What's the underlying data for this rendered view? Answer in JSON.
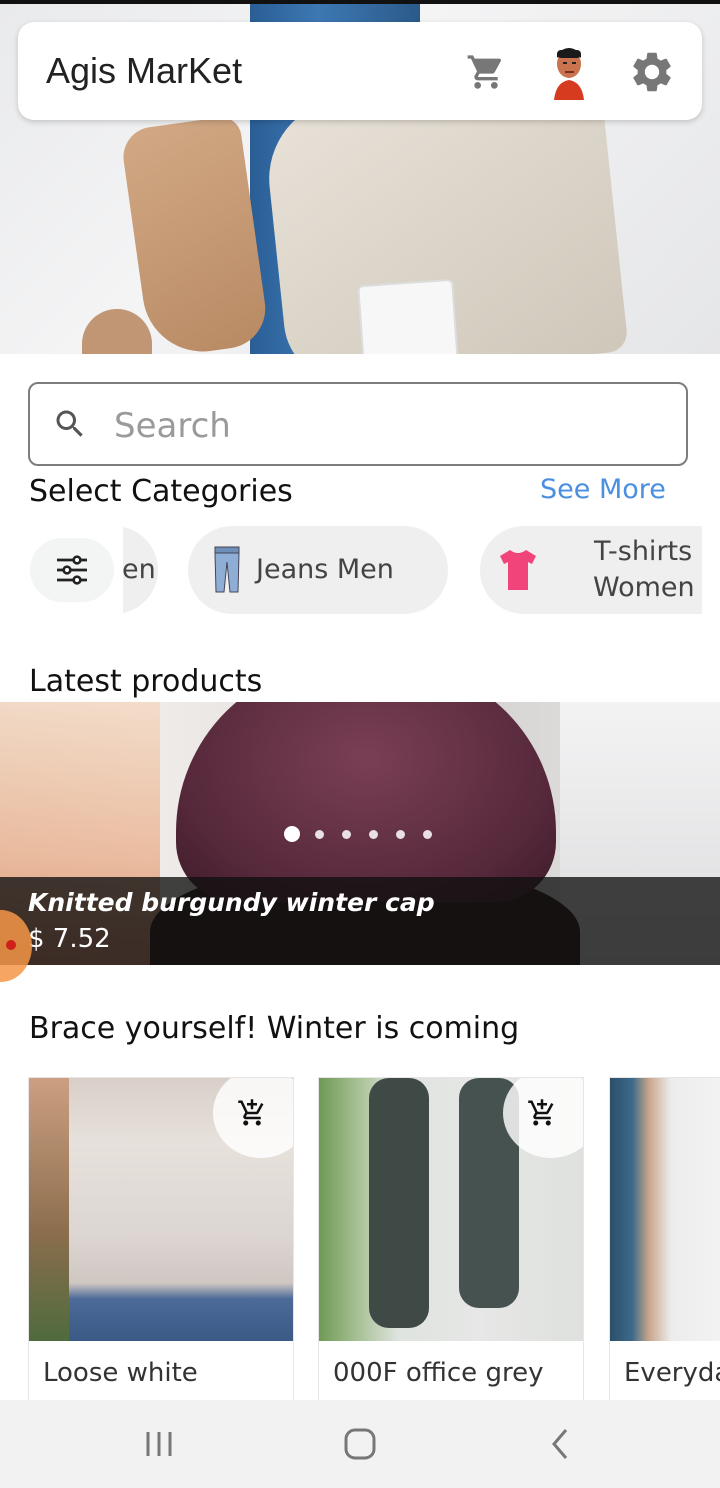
{
  "app": {
    "title": "Agis MarKet"
  },
  "search": {
    "placeholder": "Search"
  },
  "categories": {
    "title": "Select Categories",
    "see_more": "See More",
    "items": [
      {
        "label": "en",
        "icon": "partial-category-icon"
      },
      {
        "label": "Jeans Men",
        "icon": "jeans-icon"
      },
      {
        "label": "T-shirts Women",
        "line1": "T-shirts",
        "line2": "Women",
        "icon": "tshirt-icon"
      }
    ]
  },
  "latest": {
    "title": "Latest products",
    "product_name": "Knitted burgundy winter cap",
    "product_price": "$ 7.52",
    "slides": 6,
    "active_slide": 1
  },
  "winter": {
    "title": "Brace yourself! Winter is coming",
    "products": [
      {
        "name": "Loose white"
      },
      {
        "name": "000F office grey"
      },
      {
        "name": "Everyda"
      }
    ]
  },
  "colors": {
    "accent": "#4a8fe0",
    "chip_bg": "#efefef",
    "overlay": "#0f0f0f"
  },
  "nav": {
    "icons": [
      "recent-apps-icon",
      "home-icon",
      "back-icon"
    ]
  }
}
